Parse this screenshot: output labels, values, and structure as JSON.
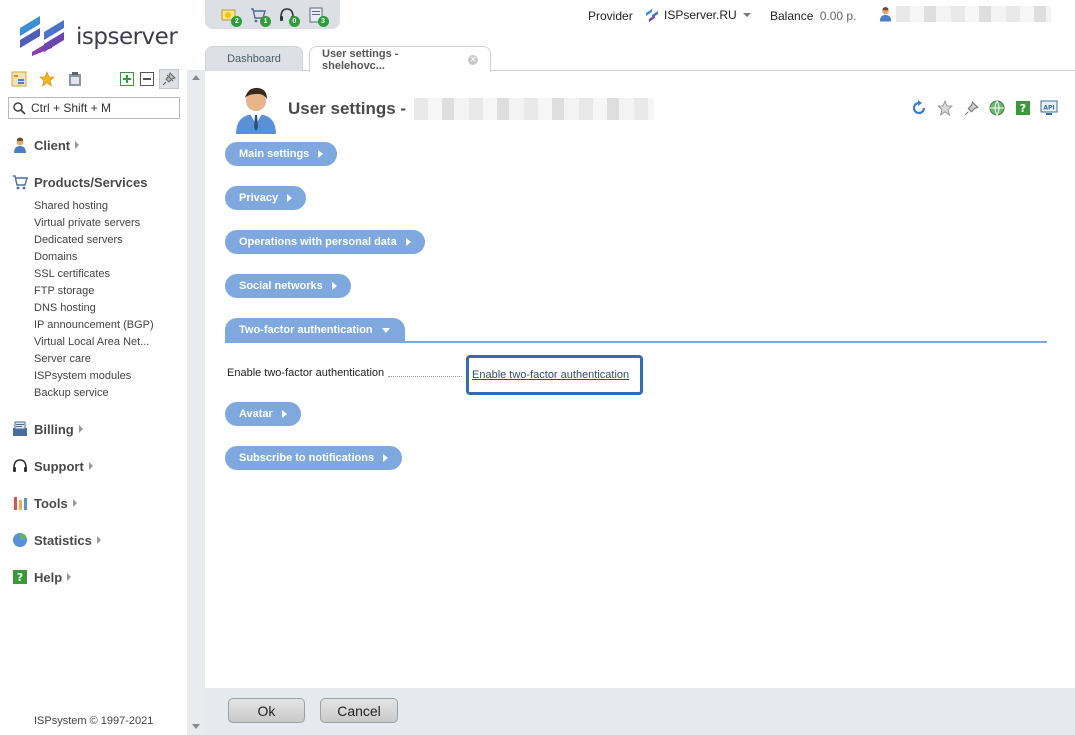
{
  "app": {
    "logo_text": "ispserver",
    "copyright": "ISPsystem © 1997-2021"
  },
  "sidebar": {
    "search_placeholder": "Ctrl + Shift + M",
    "groups": {
      "client": "Client",
      "products": "Products/Services",
      "billing": "Billing",
      "support": "Support",
      "tools": "Tools",
      "statistics": "Statistics",
      "help": "Help"
    },
    "products_items": [
      "Shared hosting",
      "Virtual private servers",
      "Dedicated servers",
      "Domains",
      "SSL certificates",
      "FTP storage",
      "DNS hosting",
      "IP announcement (BGP)",
      "Virtual Local Area Net...",
      "Server care",
      "ISPsystem modules",
      "Backup service"
    ]
  },
  "notifications": [
    {
      "icon": "lightbulb-icon",
      "count": "2"
    },
    {
      "icon": "cart-icon",
      "count": "1"
    },
    {
      "icon": "headset-icon",
      "count": "0"
    },
    {
      "icon": "document-icon",
      "count": "3"
    }
  ],
  "topbar": {
    "provider_label": "Provider",
    "provider_value": "ISPserver.RU",
    "balance_label": "Balance",
    "balance_value": "0.00 р."
  },
  "tabs": {
    "dashboard": "Dashboard",
    "user_settings": "User settings - shelehovc..."
  },
  "main": {
    "title": "User settings -",
    "sections": {
      "main_settings": "Main settings",
      "privacy": "Privacy",
      "operations": "Operations with personal data",
      "social": "Social networks",
      "two_factor": "Two-factor authentication",
      "avatar": "Avatar",
      "subscribe": "Subscribe to notifications"
    },
    "two_factor_field_label": "Enable two-factor authentication",
    "two_factor_link": "Enable two-factor authentication"
  },
  "footer": {
    "ok": "Ok",
    "cancel": "Cancel"
  },
  "colors": {
    "accent": "#7ea8de",
    "highlight": "#2e6eb5",
    "badge": "#2e9c3a"
  }
}
